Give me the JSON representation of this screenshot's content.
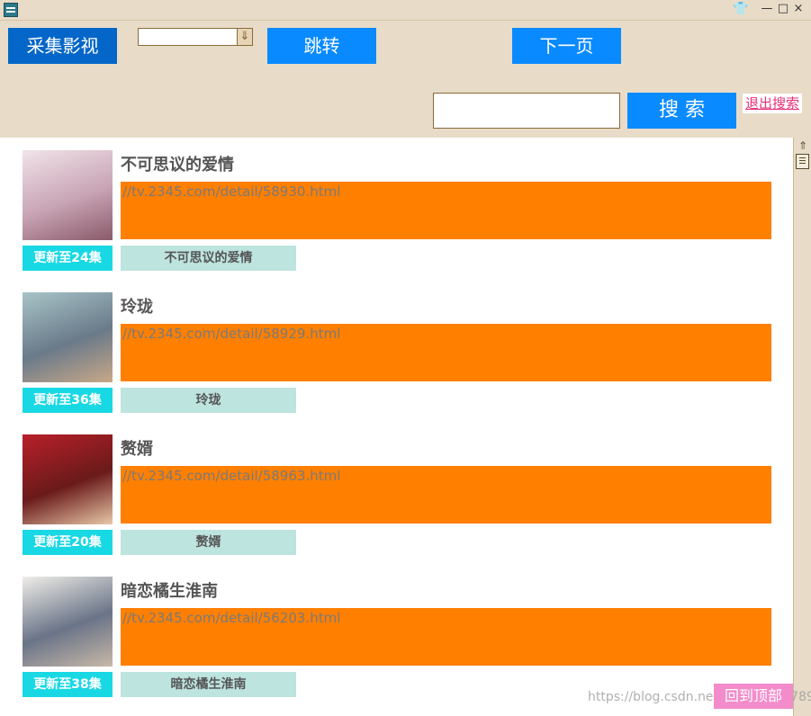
{
  "window": {
    "controls": {
      "skin": "👕",
      "minimize": "—",
      "maximize": "□",
      "close": "×"
    }
  },
  "toolbar": {
    "collect_label": "采集影视",
    "combo_value": "",
    "combo_arrow": "⇓",
    "jump_label": "跳转",
    "next_label": "下一页",
    "search_value": "",
    "search_label": "搜 索",
    "exit_search_label": "退出搜索"
  },
  "items": [
    {
      "title": "不可思议的爱情",
      "url": "//tv.2345.com/detail/58930.html",
      "episodes": "更新至24集",
      "name": "不可思议的爱情",
      "poster_colors": [
        "#f1e3ea",
        "#c8a4b4",
        "#8a5a6a"
      ]
    },
    {
      "title": "玲珑",
      "url": "//tv.2345.com/detail/58929.html",
      "episodes": "更新至36集",
      "name": "玲珑",
      "poster_colors": [
        "#a8c4c8",
        "#6a7a8a",
        "#c8a888"
      ]
    },
    {
      "title": "赘婿",
      "url": "//tv.2345.com/detail/58963.html",
      "episodes": "更新至20集",
      "name": "赘婿",
      "poster_colors": [
        "#b8202a",
        "#6a1a1a",
        "#e8c8a8"
      ]
    },
    {
      "title": "暗恋橘生淮南",
      "url": "//tv.2345.com/detail/56203.html",
      "episodes": "更新至38集",
      "name": "暗恋橘生淮南",
      "poster_colors": [
        "#f0eee8",
        "#6a7488",
        "#c8b8a8"
      ]
    }
  ],
  "scrollbar": {
    "up_arrow": "⇑"
  },
  "back_to_top_label": "回到顶部",
  "watermark": "https://blog.csdn.net/dongfeng4789"
}
